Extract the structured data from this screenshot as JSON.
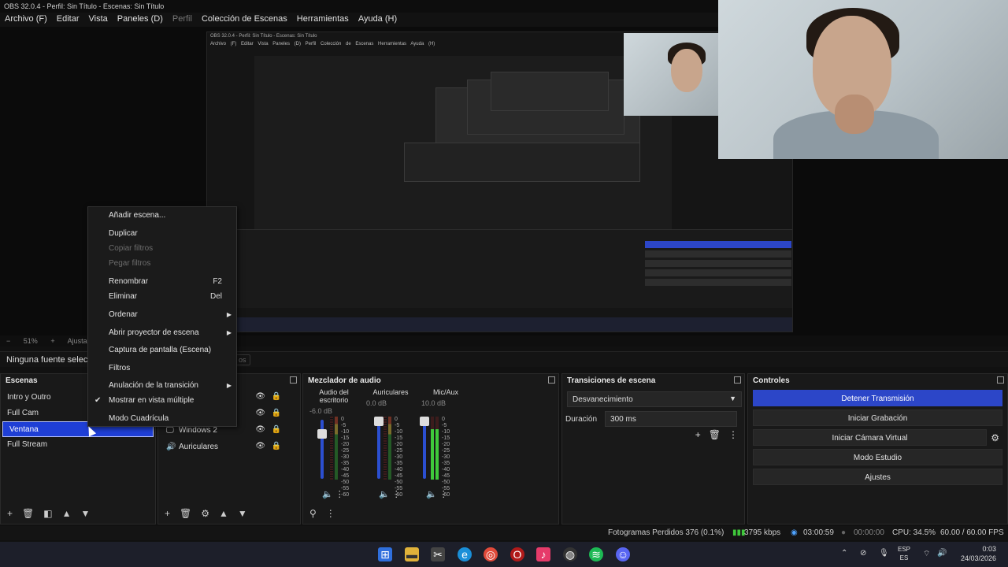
{
  "window": {
    "title": "OBS 32.0.4 - Perfil: Sin Título - Escenas: Sin Título"
  },
  "menubar": [
    {
      "label": "Archivo (F)"
    },
    {
      "label": "Editar"
    },
    {
      "label": "Vista"
    },
    {
      "label": "Paneles (D)"
    },
    {
      "label": "Perfil",
      "disabled": true
    },
    {
      "label": "Colección de Escenas"
    },
    {
      "label": "Herramientas"
    },
    {
      "label": "Ayuda (H)"
    }
  ],
  "zoom": {
    "level": "51%",
    "add": "+",
    "fit": "Ajustar a"
  },
  "sourcebar": {
    "text": "Ninguna fuente selecci",
    "tab": "os"
  },
  "scenes": {
    "title": "Escenas",
    "items": [
      {
        "label": "Intro y Outro"
      },
      {
        "label": "Full Cam"
      },
      {
        "label": "Ventana",
        "selected": true
      },
      {
        "label": "Full Stream"
      }
    ]
  },
  "sources": {
    "items": [
      {
        "label": "Windows 2",
        "icon": "monitor-icon"
      },
      {
        "label": "Auriculares",
        "icon": "speaker-icon"
      }
    ]
  },
  "mixer": {
    "title": "Mezclador de audio",
    "channels": [
      {
        "name": "Audio del escritorio",
        "db": "-6.0 dB",
        "level": 0.75
      },
      {
        "name": "Auriculares",
        "db": "0.0 dB",
        "level": 0.95
      },
      {
        "name": "Mic/Aux",
        "db": "10.0 dB",
        "level": 1.0
      }
    ],
    "ticks": [
      "0",
      "-5",
      "-10",
      "-15",
      "-20",
      "-25",
      "-30",
      "-35",
      "-40",
      "-45",
      "-50",
      "-55",
      "-60"
    ]
  },
  "transitions": {
    "title": "Transiciones de escena",
    "selected": "Desvanecimiento",
    "duration_label": "Duración",
    "duration_value": "300 ms"
  },
  "controls": {
    "title": "Controles",
    "buttons": [
      {
        "label": "Detener Transmisión",
        "primary": true
      },
      {
        "label": "Iniciar Grabación"
      },
      {
        "label": "Iniciar Cámara Virtual"
      },
      {
        "label": "Modo Estudio"
      },
      {
        "label": "Ajustes"
      }
    ]
  },
  "context_menu": {
    "items": [
      {
        "label": "Añadir escena..."
      },
      {
        "label": "Duplicar"
      },
      {
        "label": "Copiar filtros",
        "disabled": true
      },
      {
        "label": "Pegar filtros",
        "disabled": true
      },
      {
        "label": "Renombrar",
        "shortcut": "F2"
      },
      {
        "label": "Eliminar",
        "shortcut": "Del"
      },
      {
        "label": "Ordenar",
        "submenu": true
      },
      {
        "label": "Abrir proyector de escena",
        "submenu": true
      },
      {
        "label": "Captura de pantalla (Escena)"
      },
      {
        "label": "Filtros"
      },
      {
        "label": "Anulación de la transición",
        "submenu": true
      },
      {
        "label": "Mostrar en vista múltiple",
        "checked": true
      },
      {
        "label": "Modo Cuadrícula"
      }
    ]
  },
  "status": {
    "dropped": "Fotogramas Perdidos 376 (0.1%)",
    "bitrate": "3795 kbps",
    "stream_time": "03:00:59",
    "rec_time": "00:00:00",
    "cpu": "CPU: 34.5%",
    "fps": "60.00 / 60.00 FPS"
  },
  "taskbar": {
    "lang_top": "ESP",
    "lang_bottom": "ES",
    "time": "0:03",
    "date": "24/03/2026"
  },
  "colors": {
    "accent": "#2c46c8",
    "selected_scene": "#1f3fd6",
    "meter_green": "#3fc93b"
  }
}
